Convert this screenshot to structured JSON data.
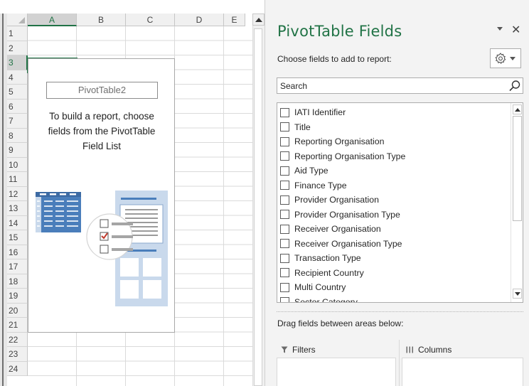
{
  "sheet": {
    "columns": [
      "A",
      "B",
      "C",
      "D",
      "E"
    ],
    "rows": [
      "1",
      "2",
      "3",
      "4",
      "5",
      "6",
      "7",
      "8",
      "9",
      "10",
      "11",
      "12",
      "13",
      "14",
      "15",
      "16",
      "17",
      "18",
      "19",
      "20",
      "21",
      "22",
      "23",
      "24"
    ],
    "selected_column": "A",
    "selected_row": "3"
  },
  "pivot": {
    "name": "PivotTable2",
    "hint_lines": [
      "To build a report, choose",
      "fields from the PivotTable",
      "Field List"
    ]
  },
  "pane": {
    "title": "PivotTable Fields",
    "choose_label": "Choose fields to add to report:",
    "search_placeholder": "Search",
    "fields": [
      {
        "label": "IATI Identifier",
        "checked": false
      },
      {
        "label": "Title",
        "checked": false
      },
      {
        "label": "Reporting Organisation",
        "checked": false
      },
      {
        "label": "Reporting Organisation Type",
        "checked": false
      },
      {
        "label": "Aid Type",
        "checked": false
      },
      {
        "label": "Finance Type",
        "checked": false
      },
      {
        "label": "Provider Organisation",
        "checked": false
      },
      {
        "label": "Provider Organisation Type",
        "checked": false
      },
      {
        "label": "Receiver Organisation",
        "checked": false
      },
      {
        "label": "Receiver Organisation Type",
        "checked": false
      },
      {
        "label": "Transaction Type",
        "checked": false
      },
      {
        "label": "Recipient Country",
        "checked": false
      },
      {
        "label": "Multi Country",
        "checked": false
      },
      {
        "label": "Sector Category",
        "checked": false
      }
    ],
    "drag_label": "Drag fields between areas below:",
    "areas": {
      "filters": "Filters",
      "columns": "Columns"
    }
  },
  "icons": {
    "settings": "gear-icon",
    "search": "search-icon",
    "close": "close-icon",
    "filters": "filter-funnel-icon",
    "columns": "columns-icon"
  },
  "colors": {
    "accent": "#217346",
    "illustration_blue": "#4a7ebb",
    "illustration_light": "#c9d9ec",
    "check_red": "#c0392b"
  }
}
